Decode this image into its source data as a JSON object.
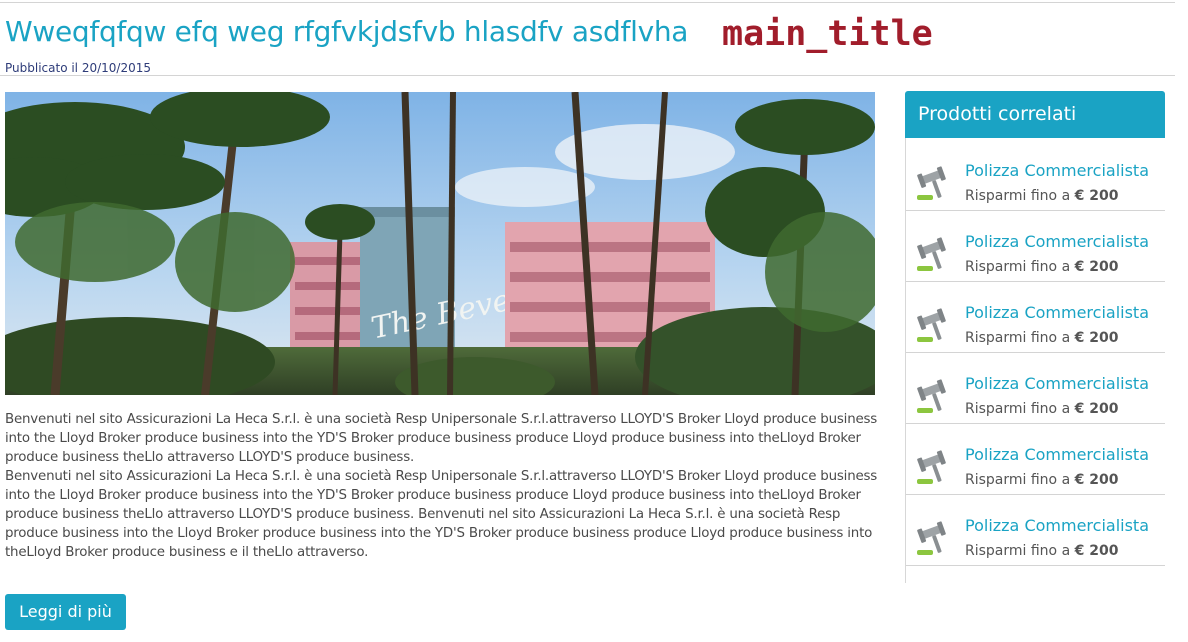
{
  "article": {
    "title": "Wweqfqfqw efq weg rfgfvkjdsfvb hlasdfv asdflvha",
    "title_tag": "main_title",
    "published": "Pubblicato il 20/10/2015",
    "image_alt": "The Beverly Hills hotel with palm trees",
    "hero_sign_text": "The Beverly",
    "paragraph_1": "Benvenuti nel sito Assicurazioni La Heca S.r.l. è una società Resp Unipersonale S.r.l.attraverso LLOYD'S Broker Lloyd produce business into the Lloyd Broker produce business into the YD'S Broker produce business produce Lloyd produce business into theLloyd Broker produce business theLlo attraverso LLOYD'S produce business.",
    "paragraph_2": "Benvenuti nel sito Assicurazioni La Heca S.r.l. è una società Resp Unipersonale S.r.l.attraverso LLOYD'S Broker Lloyd produce business into the Lloyd Broker produce business into the YD'S Broker produce business produce Lloyd produce business into theLloyd Broker produce business theLlo attraverso LLOYD'S produce business. Benvenuti nel sito Assicurazioni La Heca S.r.l. è una società Resp produce business into the Lloyd Broker produce business into the YD'S Broker produce business produce Lloyd produce business into theLloyd Broker produce business e il theLlo attraverso.",
    "read_more_label": "Leggi di più"
  },
  "sidebar": {
    "title": "Prodotti correlati",
    "items": [
      {
        "name": "Polizza Commercialista",
        "saving_prefix": "Risparmi fino a",
        "saving_amount": "€ 200",
        "icon": "gavel-icon"
      },
      {
        "name": "Polizza Commercialista",
        "saving_prefix": "Risparmi fino a",
        "saving_amount": "€ 200",
        "icon": "gavel-icon"
      },
      {
        "name": "Polizza Commercialista",
        "saving_prefix": "Risparmi fino a",
        "saving_amount": "€ 200",
        "icon": "gavel-icon"
      },
      {
        "name": "Polizza Commercialista",
        "saving_prefix": "Risparmi fino a",
        "saving_amount": "€ 200",
        "icon": "gavel-icon"
      },
      {
        "name": "Polizza Commercialista",
        "saving_prefix": "Risparmi fino a",
        "saving_amount": "€ 200",
        "icon": "gavel-icon"
      },
      {
        "name": "Polizza Commercialista",
        "saving_prefix": "Risparmi fino a",
        "saving_amount": "€ 200",
        "icon": "gavel-icon"
      }
    ]
  },
  "colors": {
    "accent": "#1aa3c4",
    "title_tag": "#a11d2b",
    "published_text": "#2e3c79",
    "body_text": "#4a4a4a"
  }
}
